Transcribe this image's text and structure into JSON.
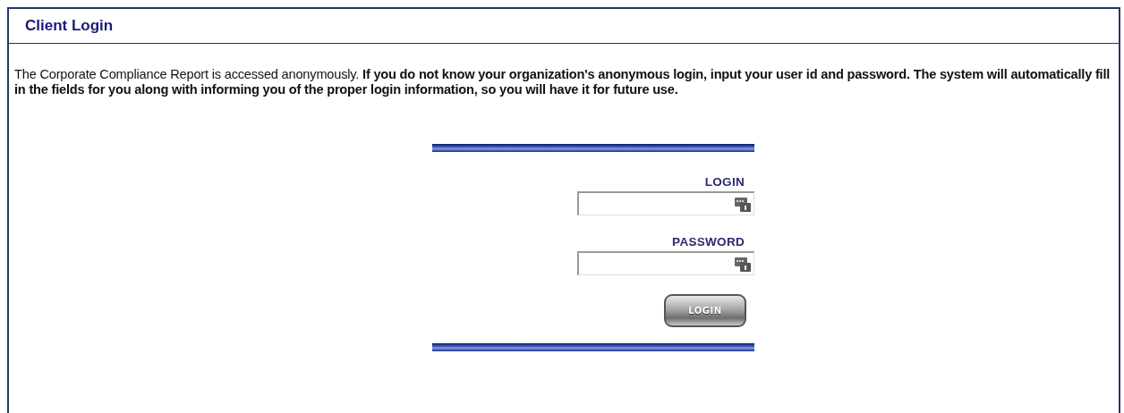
{
  "panel": {
    "title": "Client Login"
  },
  "intro": "The Corporate Compliance Report is accessed anonymously. **If you do not know your organization's anonymous login, input your user id and password. The system will automatically fill in the fields for you along with informing you of the proper login information, so you will have it for future use.**",
  "form": {
    "fields": [
      {
        "label": "LOGIN"
      },
      {
        "label": "PASSWORD"
      }
    ],
    "button": "LOGIN"
  }
}
